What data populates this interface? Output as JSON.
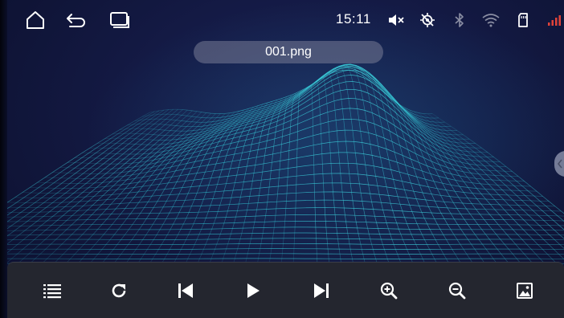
{
  "statusbar": {
    "time": "15:11",
    "nav_icons": [
      "home-icon",
      "back-icon",
      "recent-apps-icon"
    ],
    "status_icons": [
      "volume-muted-icon",
      "gps-off-icon",
      "bluetooth-icon",
      "wifi-icon",
      "sd-card-icon",
      "signal-icon"
    ]
  },
  "viewer": {
    "filename": "001.png",
    "image_subject": "wireframe-terrain-wallpaper"
  },
  "controls": {
    "items": [
      "playlist-icon",
      "refresh-icon",
      "previous-icon",
      "play-icon",
      "next-icon",
      "zoom-in-icon",
      "zoom-out-icon",
      "wallpaper-icon"
    ]
  },
  "colors": {
    "background": "#141a45",
    "wireframe": "#2fc7d6",
    "control_bar": "#24262f",
    "pill": "#787c96",
    "signal_red": "#e0433a"
  }
}
